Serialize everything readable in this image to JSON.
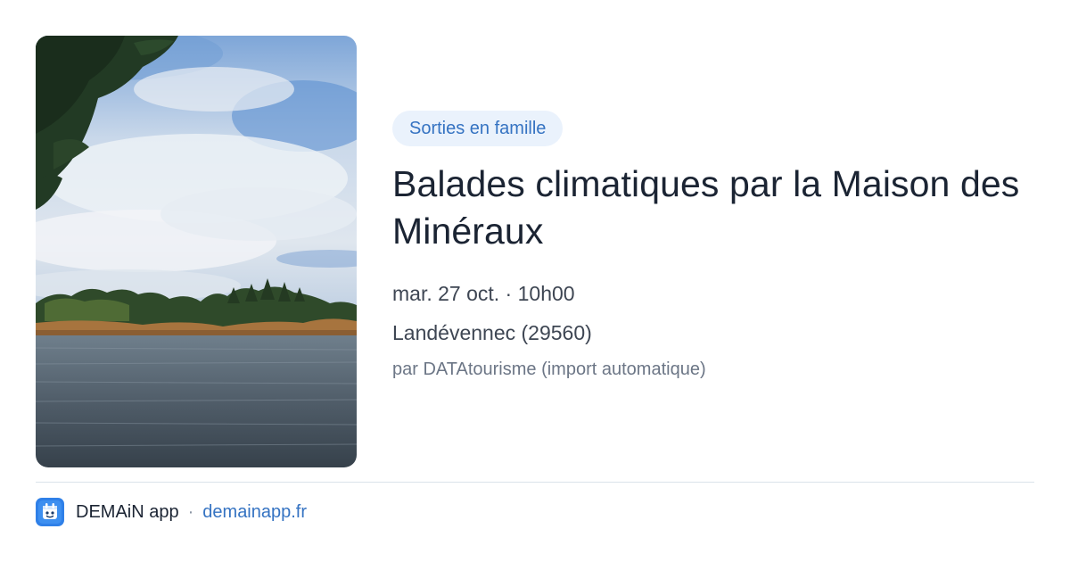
{
  "event": {
    "category_tag": "Sorties en famille",
    "title": "Balades climatiques par la Maison des Minéraux",
    "date_time": "mar. 27 oct. · 10h00",
    "location": "Landévennec (29560)",
    "source": "par DATAtourisme (import automatique)",
    "image_icon": "landscape-photo"
  },
  "footer": {
    "app_name": "DEMAiN app",
    "separator": "·",
    "domain": "demainapp.fr",
    "logo_icon": "demain-logo-icon"
  },
  "colors": {
    "accent": "#3573c2",
    "tag_background": "#eaf2fc",
    "title_text": "#1b2433",
    "secondary_text": "#3e4653",
    "muted_text": "#6c7686",
    "divider": "#dbe3ea"
  }
}
